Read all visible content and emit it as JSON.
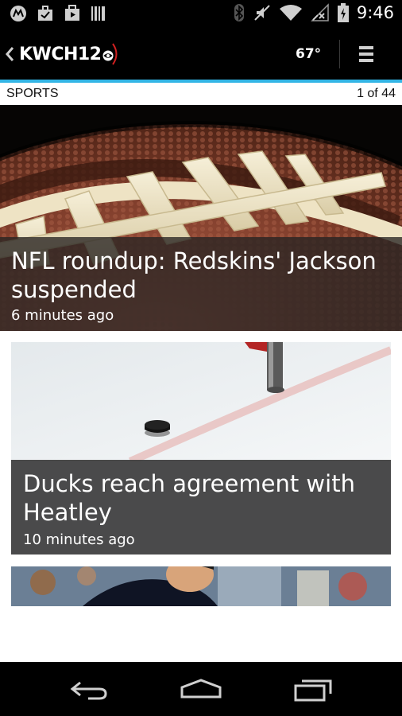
{
  "status_bar": {
    "time": "9:46",
    "icons": [
      "motorola-icon",
      "briefcase-icon",
      "play-store-icon",
      "barcode-icon",
      "bluetooth-icon",
      "mute-icon",
      "wifi-icon",
      "signal-icon",
      "battery-charging-icon"
    ]
  },
  "app_bar": {
    "logo_text": "KWCH12",
    "temperature": "67°",
    "accent_color": "#33b5e5"
  },
  "section": {
    "title": "SPORTS",
    "count": "1 of 44"
  },
  "articles": [
    {
      "headline": "NFL roundup: Redskins' Jackson suspended",
      "time": "6 minutes ago",
      "image": "football-closeup"
    },
    {
      "headline": "Ducks reach agreement with Heatley",
      "time": "10 minutes ago",
      "image": "hockey-puck-on-ice"
    },
    {
      "headline": "",
      "time": "",
      "image": "baseball-player"
    }
  ],
  "nav": {
    "icons": [
      "back-icon",
      "home-icon",
      "recent-apps-icon"
    ]
  }
}
